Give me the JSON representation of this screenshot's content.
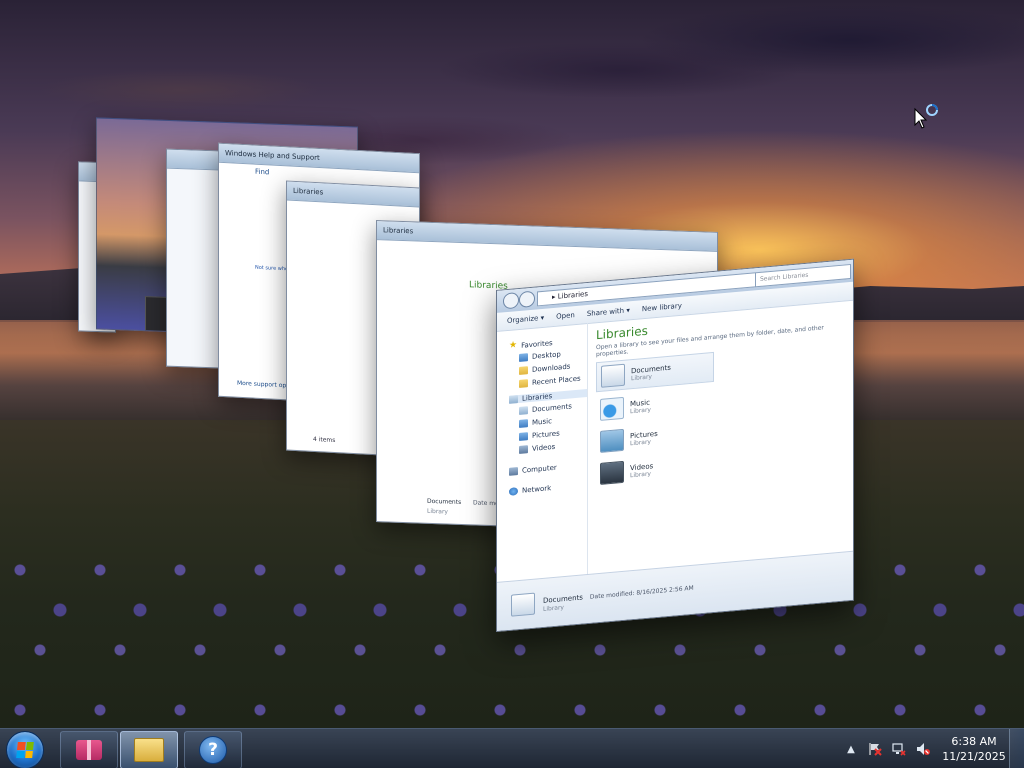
{
  "desktop": {
    "wallpaper": "lake sunset with lupine meadow"
  },
  "flip3d": {
    "back_windows": [
      {
        "title": "Windows Help and Support",
        "heading": "Find",
        "subheading": "Not sure where",
        "footer": "More support options"
      },
      {
        "title": "Libraries",
        "footer": "4 items"
      },
      {
        "title": "Libraries",
        "header": "Libraries",
        "details_name": "Documents",
        "details_meta": "Date modified",
        "details_type": "Library"
      }
    ]
  },
  "front_window": {
    "address": "Libraries",
    "address_arrow": "▸",
    "search_placeholder": "Search Libraries",
    "toolbar": {
      "organize": "Organize ▾",
      "open": "Open",
      "share_with": "Share with ▾",
      "new_library": "New library"
    },
    "nav": {
      "favorites": "Favorites",
      "favorites_items": [
        "Desktop",
        "Downloads",
        "Recent Places"
      ],
      "libraries": "Libraries",
      "libraries_items": [
        "Documents",
        "Music",
        "Pictures",
        "Videos"
      ],
      "computer": "Computer",
      "network": "Network"
    },
    "content": {
      "heading": "Libraries",
      "subtitle": "Open a library to see your files and arrange them by folder, date, and other properties.",
      "items": [
        {
          "name": "Documents",
          "type": "Library",
          "icon": "documents-library-icon"
        },
        {
          "name": "Music",
          "type": "Library",
          "icon": "music-library-icon"
        },
        {
          "name": "Pictures",
          "type": "Library",
          "icon": "pictures-library-icon"
        },
        {
          "name": "Videos",
          "type": "Library",
          "icon": "videos-library-icon"
        }
      ]
    },
    "details": {
      "name": "Documents",
      "meta": "Date modified: 8/16/2025 2:56 AM",
      "type": "Library"
    }
  },
  "taskbar": {
    "start_label": "Start",
    "buttons": [
      {
        "name": "gift-app",
        "active": false
      },
      {
        "name": "windows-explorer",
        "active": true
      },
      {
        "name": "help-and-support",
        "active": false,
        "glyph": "?"
      }
    ],
    "tray": {
      "show_hidden": "▲",
      "clock_time": "6:38 AM",
      "clock_date": "11/21/2025"
    }
  },
  "colors": {
    "taskbar": "#1a2434",
    "accent": "#1e6fc8",
    "library_heading": "#3a8a2f"
  }
}
